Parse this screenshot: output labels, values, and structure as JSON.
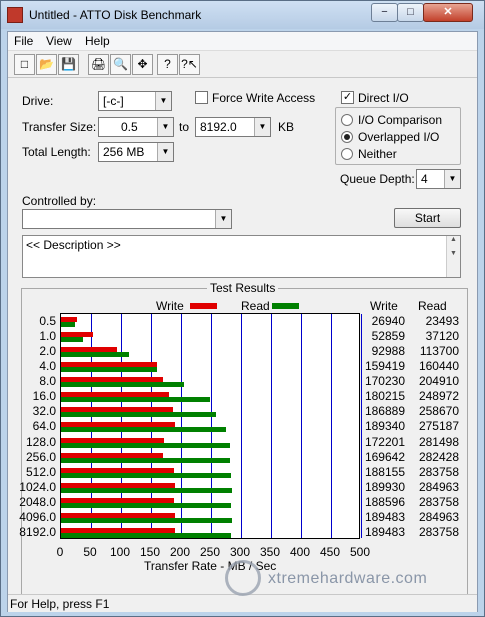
{
  "window": {
    "title": "Untitled - ATTO Disk Benchmark",
    "min_symbol": "−",
    "max_symbol": "□",
    "close_symbol": "✕"
  },
  "menu": {
    "file": "File",
    "view": "View",
    "help": "Help"
  },
  "toolbar": {
    "icons": [
      "new-icon",
      "open-icon",
      "save-icon",
      "print-icon",
      "print-preview-icon",
      "move-icon",
      "help-icon",
      "context-help-icon"
    ],
    "glyphs": [
      "□",
      "📂",
      "💾",
      "🖨",
      "🔍",
      "✥",
      "?",
      "?↖"
    ]
  },
  "form": {
    "drive_label": "Drive:",
    "drive_value": "[-c-]",
    "force_write_label": "Force Write Access",
    "direct_io_label": "Direct I/O",
    "direct_io_checked": "✓",
    "transfer_size_label": "Transfer Size:",
    "transfer_from": "0.5",
    "to_label": "to",
    "transfer_to": "8192.0",
    "kb_label": "KB",
    "total_length_label": "Total Length:",
    "total_length_value": "256 MB",
    "io_comparison_label": "I/O Comparison",
    "overlapped_io_label": "Overlapped I/O",
    "neither_label": "Neither",
    "selected_mode": "Overlapped I/O",
    "queue_depth_label": "Queue Depth:",
    "queue_depth_value": "4",
    "controlled_by_label": "Controlled by:",
    "controlled_by_value": "",
    "start_label": "Start",
    "description_text": "<< Description >>"
  },
  "results": {
    "group_title": "Test Results",
    "write_legend": "Write",
    "read_legend": "Read",
    "write_col_header": "Write",
    "read_col_header": "Read",
    "write_color": "#e00000",
    "read_color": "#008000",
    "grid_color": "#0000cc"
  },
  "chart_data": {
    "type": "bar",
    "orientation": "horizontal",
    "categories": [
      "0.5",
      "1.0",
      "2.0",
      "4.0",
      "8.0",
      "16.0",
      "32.0",
      "64.0",
      "128.0",
      "256.0",
      "512.0",
      "1024.0",
      "2048.0",
      "4096.0",
      "8192.0"
    ],
    "series": [
      {
        "name": "Write",
        "values": [
          26940,
          52859,
          92988,
          159419,
          170230,
          180215,
          186889,
          189340,
          172201,
          169642,
          188155,
          189930,
          188596,
          189483,
          189483
        ]
      },
      {
        "name": "Read",
        "values": [
          23493,
          37120,
          113700,
          160440,
          204910,
          248972,
          258670,
          275187,
          281498,
          282428,
          283758,
          284963,
          283758,
          284963,
          283758
        ]
      }
    ],
    "xlabel": "Transfer Rate - MB / Sec",
    "xlim": [
      0,
      500
    ],
    "xticks": [
      "0",
      "50",
      "100",
      "150",
      "200",
      "250",
      "300",
      "350",
      "400",
      "450",
      "500"
    ],
    "grid": true
  },
  "status": {
    "text": "For Help, press F1"
  },
  "watermark": {
    "text": "xtremehardware.com"
  }
}
